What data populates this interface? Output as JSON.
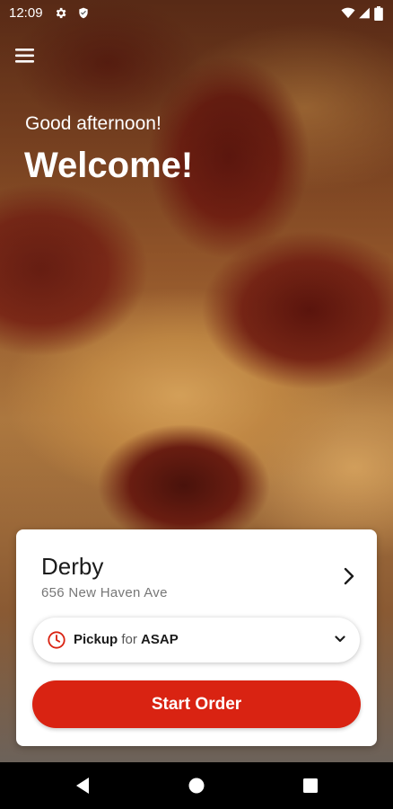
{
  "status_bar": {
    "time": "12:09",
    "icons": [
      "gear-icon",
      "shield-icon",
      "wifi-icon",
      "signal-icon",
      "battery-icon"
    ]
  },
  "header": {
    "menu_icon": "hamburger-menu-icon",
    "greeting": "Good afternoon!",
    "title": "Welcome!"
  },
  "store_card": {
    "name": "Derby",
    "address": "656 New Haven Ave",
    "chevron_icon": "chevron-right-icon",
    "order_type": {
      "icon": "clock-icon",
      "mode": "Pickup",
      "connector": "for",
      "time": "ASAP",
      "dropdown_icon": "chevron-down-icon"
    },
    "start_button_label": "Start Order"
  },
  "nav_bar": {
    "icons": [
      "back-icon",
      "home-icon",
      "recents-icon"
    ]
  },
  "colors": {
    "accent": "#d92312",
    "text_primary": "#1b1b1b",
    "text_secondary": "#777777"
  }
}
